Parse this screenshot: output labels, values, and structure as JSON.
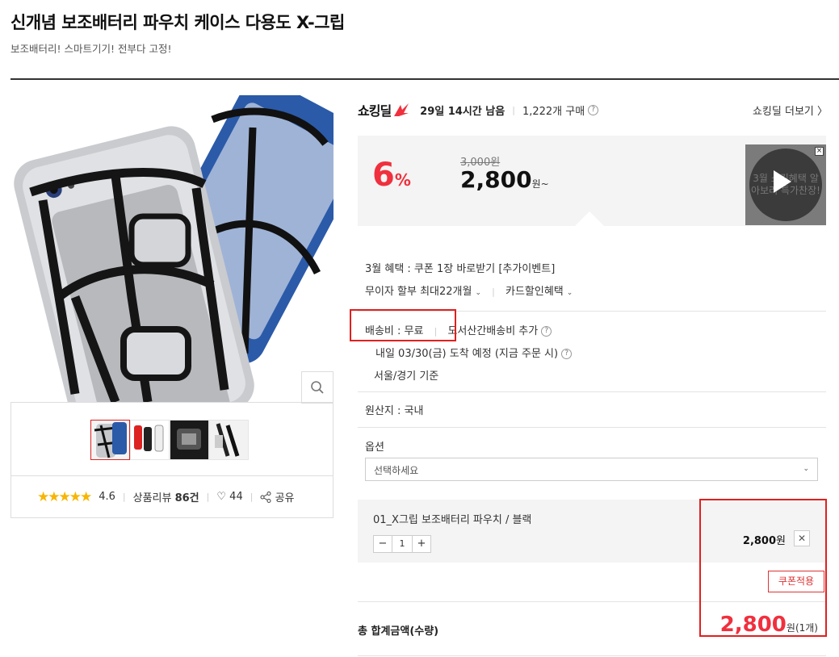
{
  "product": {
    "title": "신개념 보조배터리 파우치 케이스 다용도 X-그립",
    "subtitle": "보조배터리! 스마트기기! 전부다 고정!"
  },
  "review": {
    "rating": "4.6",
    "reviews_label": "상품리뷰",
    "reviews_count": "86건",
    "likes": "44",
    "share_label": "공유"
  },
  "shocking_deal": {
    "logo": "쇼킹딜",
    "time_left": "29일 14시간 남음",
    "purchases": "1,222개 구매",
    "more_link": "쇼킹딜 더보기 〉"
  },
  "price": {
    "discount_num": "6",
    "discount_pct": "%",
    "original": "3,000원",
    "sale": "2,800",
    "sale_unit": "원~"
  },
  "video": {
    "overlay_text": "3월 쇼킹혜택 알아보러 특가찬장!"
  },
  "benefits": {
    "march": "3월 혜택 : 쿠폰 1장 바로받기 [추가이벤트]",
    "installment": "무이자 할부 최대22개월",
    "card": "카드할인혜택"
  },
  "shipping": {
    "fee": "배송비 : 무료",
    "remote": "도서산간배송비 추가",
    "arrival": "내일 03/30(금) 도착 예정 (지금 주문 시)",
    "region": "서울/경기 기준"
  },
  "origin": {
    "text": "원산지 : 국내"
  },
  "options": {
    "label": "옵션",
    "placeholder": "선택하세요"
  },
  "selected": {
    "name": "01_X그립 보조배터리 파우치 / 블랙",
    "qty": "1",
    "minus": "−",
    "plus": "+",
    "price": "2,800",
    "price_unit": "원",
    "remove": "✕"
  },
  "coupon": {
    "label": "쿠폰적용"
  },
  "total": {
    "label": "총 합계금액(수량)",
    "amount": "2,800",
    "unit": "원(1개)"
  },
  "colors": {
    "accent_red": "#f0303e",
    "highlight_box": "#e02020",
    "star": "#f7b500"
  }
}
